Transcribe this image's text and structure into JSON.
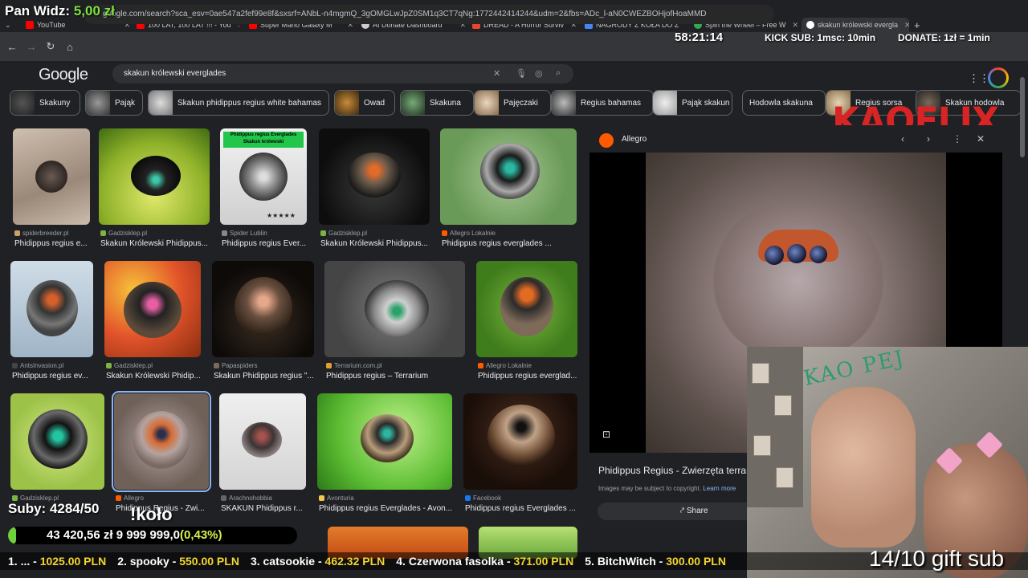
{
  "tabs": [
    {
      "label": "YouTube",
      "color": "#ff0000"
    },
    {
      "label": "100 LAT, 100 LAT !!! - You",
      "color": "#ff0000"
    },
    {
      "label": "Super Mario Galaxy M",
      "color": "#ff0000"
    },
    {
      "label": "AI Donate Dashboard",
      "color": "#cccccc"
    },
    {
      "label": "DREAD - A Horror Surviv",
      "color": "#e8432e"
    },
    {
      "label": "NAGRODY Z KOŁA DO Z",
      "color": "#4285f4"
    },
    {
      "label": "Spin the Wheel – Free W",
      "color": "#34a853"
    },
    {
      "label": "skakun królewski evergla",
      "color": "#ffffff"
    }
  ],
  "url": "google.com/search?sca_esv=0ae547a2fef99e8f&sxsrf=ANbL-n4mgmQ_3gOMGLwJpZ0SM1q3CT7qNg:1772442414244&udm=2&fbs=ADc_l-aN0CWEZBOHjofHoaMMD",
  "overlays": {
    "streamer": "Pan Widz:",
    "balance": "5,00 zł",
    "timer": "58:21:14",
    "kick_sub": "KICK SUB: 1msc: 10min",
    "donate": "DONATE: 1zł = 1min",
    "kaoflix": "KAOFLIX",
    "subs": "Suby: 4284/50",
    "kolo": "!koło",
    "progress_text": "43 420,56 zł  9 999 999,0",
    "progress_pct_text": "(0,43%)",
    "progress_fraction": 0.0043,
    "gift": "14/10 gift sub",
    "cam_scribble": "KAO PEJ",
    "ticker": [
      {
        "name": "1. ... -",
        "value": "1025.00 PLN"
      },
      {
        "name": "2. spooky -",
        "value": "550.00 PLN"
      },
      {
        "name": "3. catsookie -",
        "value": "462.32 PLN"
      },
      {
        "name": "4. Czerwona fasolka -",
        "value": "371.00 PLN"
      },
      {
        "name": "5. BitchWitch -",
        "value": "300.00 PLN"
      }
    ]
  },
  "google": {
    "logo": "Google",
    "query": "skakun królewski everglades"
  },
  "chips": [
    {
      "label": "Skakuny",
      "img": true
    },
    {
      "label": "Pająk",
      "img": true
    },
    {
      "label": "Skakun phidippus regius white bahamas",
      "img": true
    },
    {
      "label": "Owad",
      "img": true
    },
    {
      "label": "Skakuna",
      "img": true
    },
    {
      "label": "Pajęczaki",
      "img": true
    },
    {
      "label": "Regius bahamas",
      "img": true
    },
    {
      "label": "Pająk skakun",
      "img": true
    },
    {
      "label": "Hodowla skakuna",
      "img": false
    },
    {
      "label": "Regius sorsa",
      "img": true
    },
    {
      "label": "Skakun hodowla",
      "img": true
    }
  ],
  "results": [
    {
      "source": "spiderbreeder.pl",
      "title": "Phidippus regius e...",
      "src_color": "#c9a36b"
    },
    {
      "source": "Gadzisklep.pl",
      "title": "Skakun Królewski Phidippus...",
      "src_color": "#7cb342"
    },
    {
      "source": "Spider Lublin",
      "title": "Phidippus regius Ever...",
      "src_color": "#888888"
    },
    {
      "source": "Gadzisklep.pl",
      "title": "Skakun Królewski Phidippus...",
      "src_color": "#7cb342"
    },
    {
      "source": "Allegro Lokalnie",
      "title": "Phidippus regius everglades ...",
      "src_color": "#ff5a00"
    },
    {
      "source": "AntsInvasion.pl",
      "title": "Phidippus regius ev...",
      "src_color": "#444444"
    },
    {
      "source": "Gadzisklep.pl",
      "title": "Skakun Królewski Phidip...",
      "src_color": "#7cb342"
    },
    {
      "source": "Papaspiders",
      "title": "Skakun Phidippus regius \"...",
      "src_color": "#7a6a5a"
    },
    {
      "source": "Terrarium.com.pl",
      "title": "Phidippus regius – Terrarium",
      "src_color": "#e0a030"
    },
    {
      "source": "Allegro Lokalnie",
      "title": "Phidippus regius everglad...",
      "src_color": "#ff5a00"
    },
    {
      "source": "Gadzisklep.pl",
      "title": "",
      "src_color": "#7cb342"
    },
    {
      "source": "Allegro",
      "title": "Phidippus Regius - Zwi...",
      "src_color": "#ff5a00"
    },
    {
      "source": "Arachnohobbia",
      "title": "SKAKUN Phidippus r...",
      "src_color": "#666666"
    },
    {
      "source": "Avonturia",
      "title": "Phidippus regius Everglades - Avon...",
      "src_color": "#f2c94c"
    },
    {
      "source": "Facebook",
      "title": "Phidippus regius Everglades ...",
      "src_color": "#1877f2"
    }
  ],
  "thumb_text": {
    "banner": "Phidippus regius Everglades Skakun królewski"
  },
  "panel": {
    "site": "Allegro",
    "title": "Phidippus Regius - Zwierzęta terrar",
    "copyright": "Images may be subject to copyright.",
    "learn_more": "Learn more",
    "share": "Share"
  }
}
